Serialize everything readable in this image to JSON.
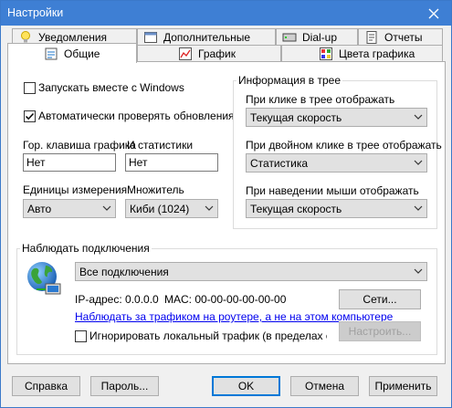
{
  "window": {
    "title": "Настройки"
  },
  "tabs_row1": [
    {
      "label": "Уведомления",
      "icon": "lightbulb-icon"
    },
    {
      "label": "Дополнительные",
      "icon": "settings-window-icon"
    },
    {
      "label": "Dial-up",
      "icon": "modem-icon"
    },
    {
      "label": "Отчеты",
      "icon": "report-icon"
    }
  ],
  "tabs_row2": [
    {
      "label": "Общие",
      "icon": "general-icon",
      "active": true
    },
    {
      "label": "График",
      "icon": "chart-icon"
    },
    {
      "label": "Цвета графика",
      "icon": "palette-icon"
    }
  ],
  "general": {
    "autostart_label": "Запускать вместе с Windows",
    "autostart_checked": false,
    "autoupdate_label": "Автоматически проверять обновления",
    "autoupdate_checked": true,
    "hotkey_graph_label": "Гор. клавиша графика",
    "hotkey_stats_label": "И статистики",
    "hotkey_graph_value": "Нет",
    "hotkey_stats_value": "Нет",
    "units_label": "Единицы измерения",
    "units_value": "Авто",
    "multiplier_label": "Множитель",
    "multiplier_value": "Киби (1024)"
  },
  "tray": {
    "group_title": "Информация в трее",
    "click_label": "При клике в трее отображать",
    "click_value": "Текущая скорость",
    "dblclick_label": "При двойном клике в трее отображать",
    "dblclick_value": "Статистика",
    "hover_label": "При наведении мыши отображать",
    "hover_value": "Текущая скорость"
  },
  "monitor": {
    "group_title": "Наблюдать подключения",
    "connection_value": "Все подключения",
    "ip_text": "IP-адрес: 0.0.0.0",
    "mac_text": "MAC: 00-00-00-00-00-00",
    "networks_button": "Сети...",
    "router_link": "Наблюдать за трафиком на роутере, а не на этом компьютере",
    "ignore_local_label": "Игнорировать локальный трафик (в пределах сети",
    "ignore_local_checked": false,
    "configure_button": "Настроить..."
  },
  "footer": {
    "help": "Справка",
    "password": "Пароль...",
    "ok": "OK",
    "cancel": "Отмена",
    "apply": "Применить"
  },
  "colors": {
    "titlebar": "#3e7fd4",
    "focus": "#0078d7",
    "link": "#0000ee"
  }
}
